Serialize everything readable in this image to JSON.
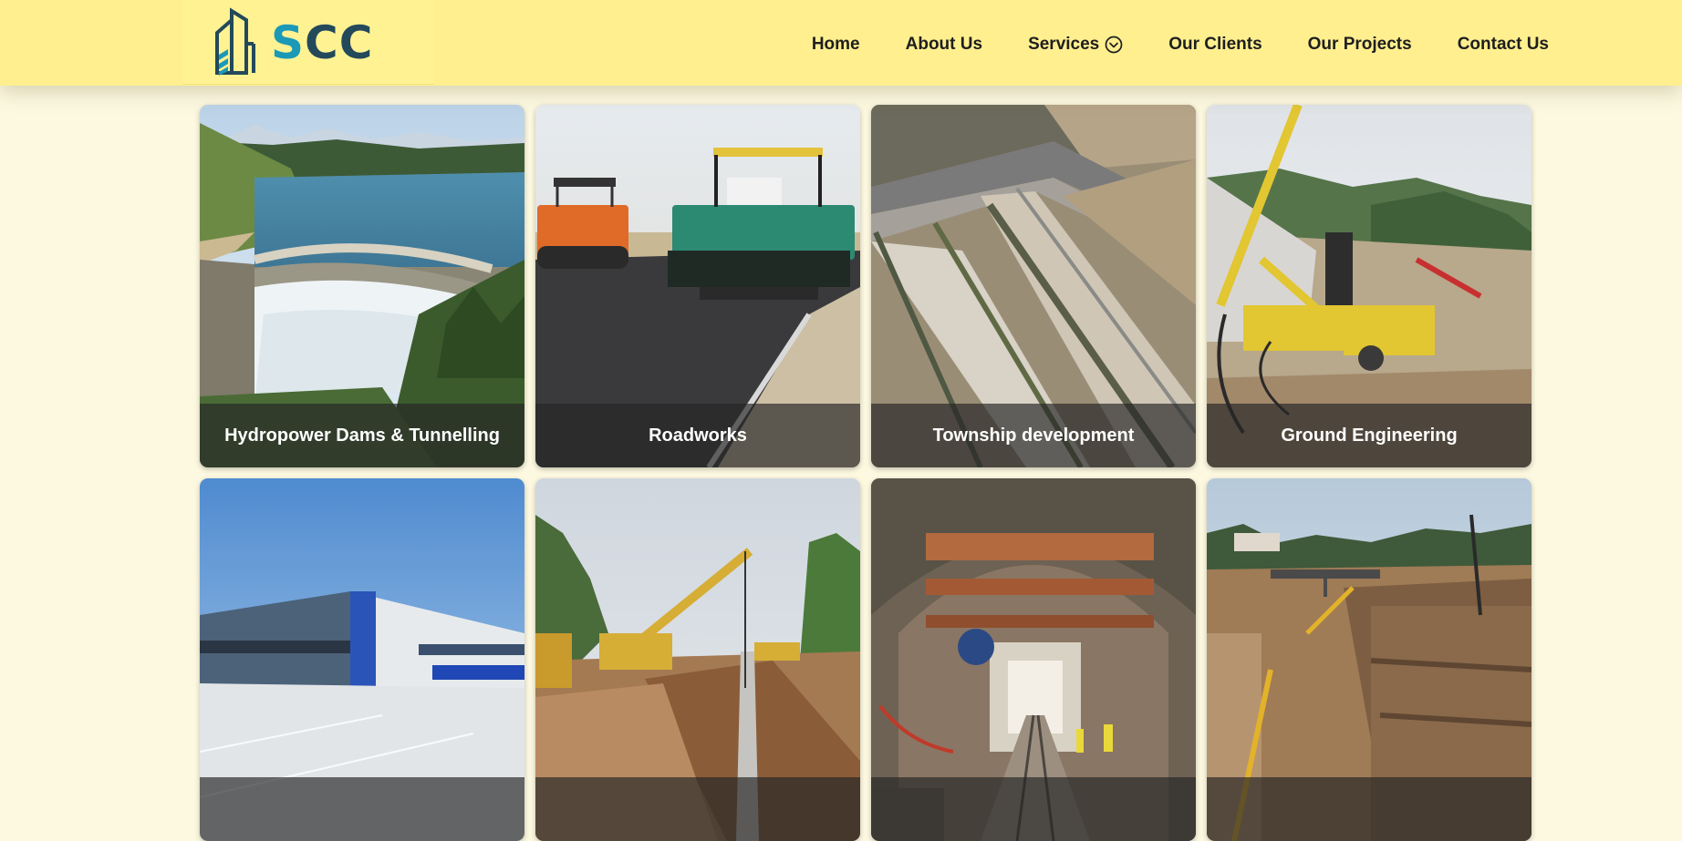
{
  "brand": {
    "name_part1": "S",
    "name_part2": "CC",
    "colors": {
      "teal": "#1b99b7",
      "dark": "#23495a",
      "header_bg": "#ffef8f"
    }
  },
  "nav": {
    "items": [
      {
        "label": "Home"
      },
      {
        "label": "About Us"
      },
      {
        "label": "Services",
        "icon": "chevron-down-circle-icon"
      },
      {
        "label": "Our Clients"
      },
      {
        "label": "Our Projects"
      },
      {
        "label": "Contact Us"
      }
    ]
  },
  "services": {
    "cards": [
      {
        "title": "Hydropower Dams & Tunnelling",
        "image": "dam-spillway-photo"
      },
      {
        "title": "Roadworks",
        "image": "asphalt-paver-photo"
      },
      {
        "title": "Township development",
        "image": "township-aerial-photo"
      },
      {
        "title": "Ground Engineering",
        "image": "drilling-rig-photo"
      },
      {
        "title": "",
        "image": "warehouse-building-photo"
      },
      {
        "title": "",
        "image": "pipeline-trench-photo"
      },
      {
        "title": "",
        "image": "tunnel-interior-photo"
      },
      {
        "title": "",
        "image": "excavation-site-photo"
      }
    ]
  }
}
